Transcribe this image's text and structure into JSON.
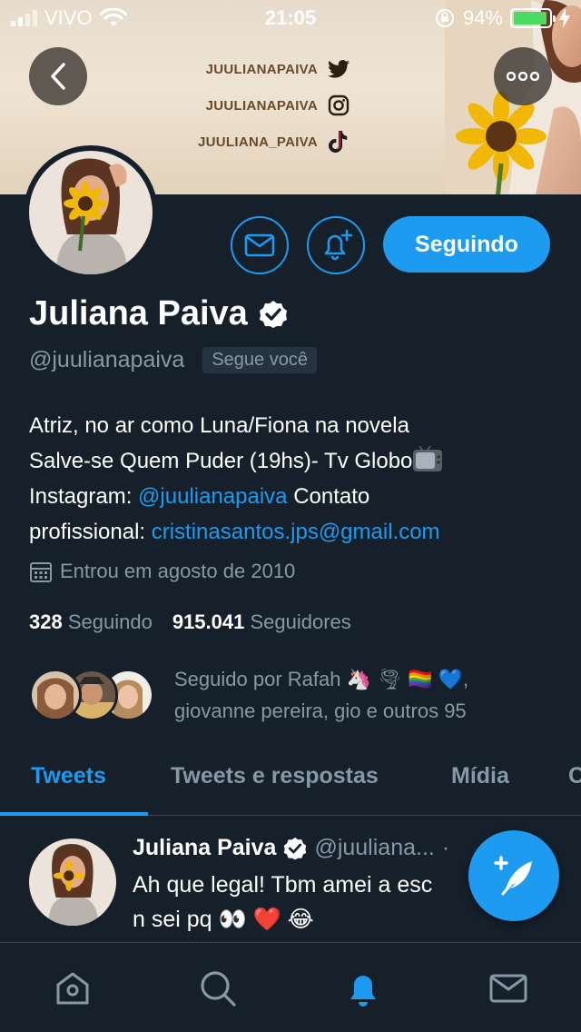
{
  "status_bar": {
    "carrier": "VIVO",
    "time": "21:05",
    "battery": "94%",
    "battery_level": 0.94
  },
  "banner": {
    "social": [
      {
        "handle": "JUULIANAPAIVA",
        "icon": "twitter-icon"
      },
      {
        "handle": "JUULIANAPAIVA",
        "icon": "instagram-icon"
      },
      {
        "handle": "JUULIANA_PAIVA",
        "icon": "tiktok-icon"
      }
    ]
  },
  "actions": {
    "following_label": "Seguindo"
  },
  "profile": {
    "name": "Juliana Paiva",
    "handle": "@juulianapaiva",
    "follows_you": "Segue você",
    "bio": {
      "line1": "Atriz, no ar como Luna/Fiona na novela",
      "line2": "Salve-se Quem Puder (19hs)- Tv Globo",
      "instagram_prefix": "Instagram: ",
      "instagram_link": "@juulianapaiva",
      "contact_prefix": " Contato",
      "contact_label": "profissional: ",
      "email": "cristinasantos.jps@gmail.com"
    },
    "joined": "Entrou em agosto de 2010",
    "following_count": "328",
    "following_label": "Seguindo",
    "followers_count": "915.041",
    "followers_label": "Seguidores",
    "followed_by_line1": "Seguido por Rafah 🦄 🌪 🏳️‍🌈 💙,",
    "followed_by_line2": "giovanne pereira, gio e outros 95"
  },
  "tabs": [
    {
      "label": "Tweets",
      "active": true
    },
    {
      "label": "Tweets e respostas",
      "active": false
    },
    {
      "label": "Mídia",
      "active": false
    },
    {
      "label": "C",
      "active": false
    }
  ],
  "tweet": {
    "name": "Juliana Paiva",
    "handle": "@juuliana...",
    "separator": "·",
    "line1": "Ah que legal! Tbm amei a esc",
    "line2": "n sei pq 👀 ❤️ 😂"
  },
  "colors": {
    "background": "#15202b",
    "accent": "#1d9bf0",
    "muted": "#8899a6",
    "battery": "#4cd964"
  },
  "nav": [
    "home-icon",
    "search-icon",
    "notifications-icon",
    "messages-icon"
  ]
}
